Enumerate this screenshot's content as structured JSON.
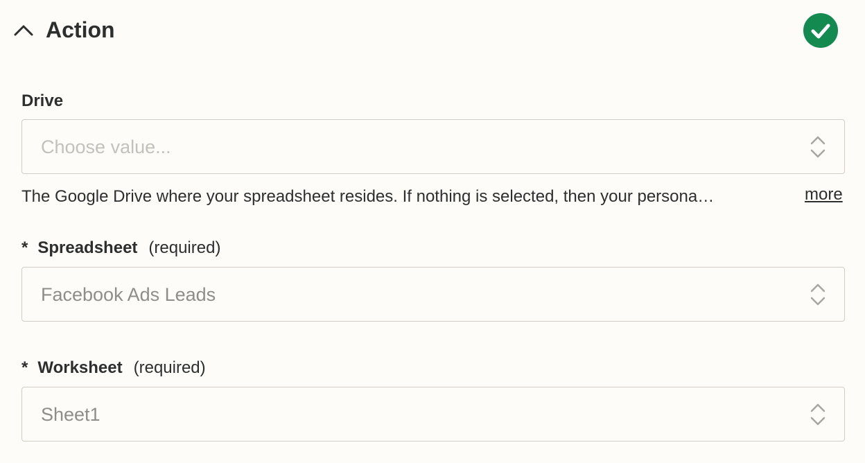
{
  "section": {
    "title": "Action",
    "collapse_icon": "chevron-up-icon",
    "status_icon": "check-circle-icon",
    "status_color": "#138a4f"
  },
  "fields": {
    "drive": {
      "label": "Drive",
      "placeholder": "Choose value...",
      "help": "The Google Drive where your spreadsheet resides. If nothing is selected, then your persona…",
      "more_label": "more"
    },
    "spreadsheet": {
      "star": "*",
      "label": "Spreadsheet",
      "required_hint": "(required)",
      "value": "Facebook Ads Leads"
    },
    "worksheet": {
      "star": "*",
      "label": "Worksheet",
      "required_hint": "(required)",
      "value": "Sheet1"
    }
  },
  "icons": {
    "select_arrows": "chevron-up-down-icon"
  }
}
